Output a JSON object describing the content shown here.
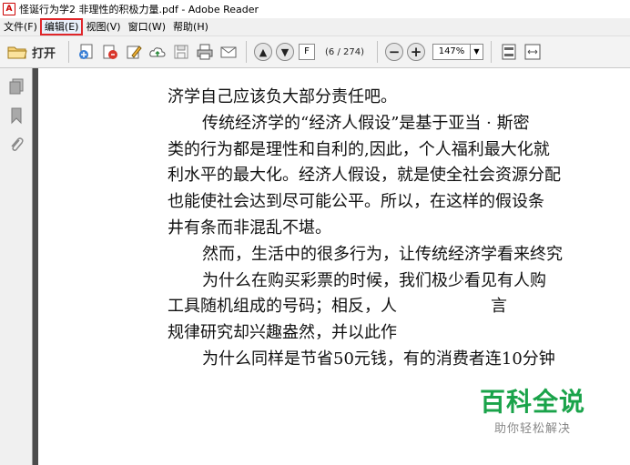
{
  "window": {
    "title": "怪诞行为学2 非理性的积极力量.pdf - Adobe Reader",
    "app_icon_glyph": "A"
  },
  "menu": [
    {
      "label": "文件(F)",
      "highlighted": false
    },
    {
      "label": "编辑(E)",
      "highlighted": true
    },
    {
      "label": "视图(V)",
      "highlighted": false
    },
    {
      "label": "窗口(W)",
      "highlighted": false
    },
    {
      "label": "帮助(H)",
      "highlighted": false
    }
  ],
  "toolbar": {
    "open_label": "打开",
    "page_input": "F",
    "page_count": "(6 / 274)",
    "zoom_value": "147%",
    "zoom_dropdown_glyph": "▼",
    "prev_glyph": "▲",
    "next_glyph": "▼",
    "zoom_out_glyph": "−",
    "zoom_in_glyph": "+"
  },
  "document": {
    "lines": [
      {
        "text": "济学自己应该负大部分责任吧。",
        "indent": false
      },
      {
        "text": "传统经济学的“经济人假设”是基于亚当 · 斯密",
        "indent": true
      },
      {
        "text": "类的行为都是理性和自利的,因此，个人福利最大化就",
        "indent": false
      },
      {
        "text": "利水平的最大化。经济人假设，就是使全社会资源分配",
        "indent": false
      },
      {
        "text": "也能使社会达到尽可能公平。所以，在这样的假设条",
        "indent": false
      },
      {
        "text": "井有条而非混乱不堪。",
        "indent": false
      },
      {
        "text": "然而，生活中的很多行为，让传统经济学看来终究",
        "indent": true
      },
      {
        "text": "为什么在购买彩票的时候，我们极少看见有人购",
        "indent": true
      },
      {
        "text": "工具随机组成的号码；相反，人                  言",
        "indent": false
      },
      {
        "text": "规律研究却兴趣盎然，并以此作",
        "indent": false
      },
      {
        "text": "为什么同样是节省50元钱，有的消费者连10分钟",
        "indent": true
      }
    ]
  },
  "watermark": {
    "main": "百科全说",
    "sub": "助你轻松解决"
  }
}
